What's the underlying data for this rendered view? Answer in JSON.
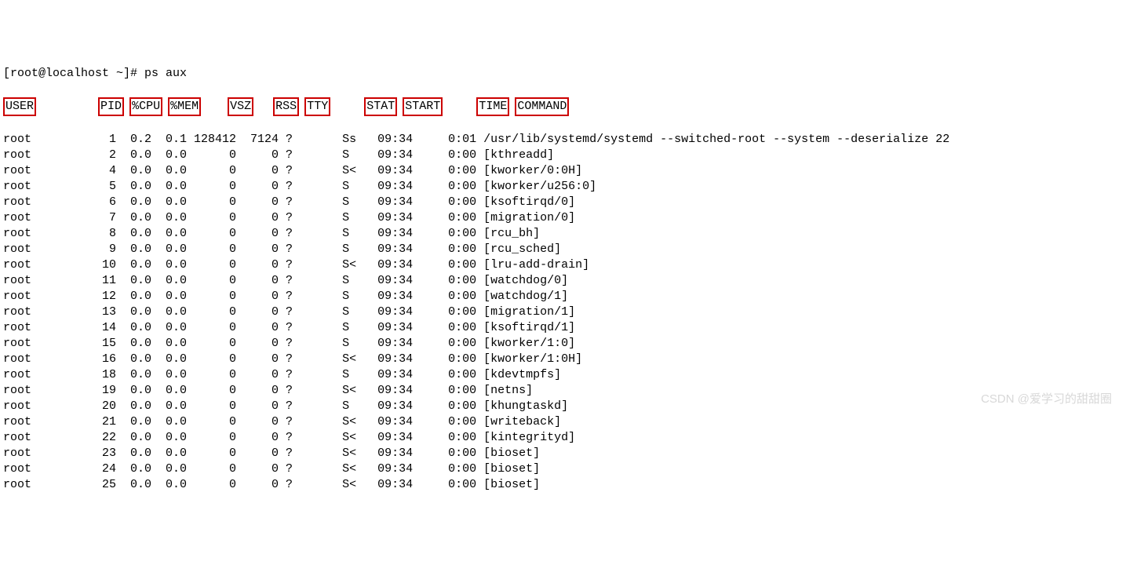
{
  "prompt": "[root@localhost ~]# ps aux",
  "headers": [
    "USER",
    "PID",
    "%CPU",
    "%MEM",
    "VSZ",
    "RSS",
    "TTY",
    "STAT",
    "START",
    "TIME",
    "COMMAND"
  ],
  "col_widths": {
    "user": 8,
    "pid": 8,
    "cpu": 5,
    "mem": 5,
    "vsz": 7,
    "rss": 6,
    "tty": 9,
    "stat": 5,
    "start": 7,
    "time": 7
  },
  "rows": [
    {
      "user": "root",
      "pid": 1,
      "cpu": "0.2",
      "mem": "0.1",
      "vsz": 128412,
      "rss": 7124,
      "tty": "?",
      "stat": "Ss",
      "start": "09:34",
      "time": "0:01",
      "command": "/usr/lib/systemd/systemd --switched-root --system --deserialize 22"
    },
    {
      "user": "root",
      "pid": 2,
      "cpu": "0.0",
      "mem": "0.0",
      "vsz": 0,
      "rss": 0,
      "tty": "?",
      "stat": "S",
      "start": "09:34",
      "time": "0:00",
      "command": "[kthreadd]"
    },
    {
      "user": "root",
      "pid": 4,
      "cpu": "0.0",
      "mem": "0.0",
      "vsz": 0,
      "rss": 0,
      "tty": "?",
      "stat": "S<",
      "start": "09:34",
      "time": "0:00",
      "command": "[kworker/0:0H]"
    },
    {
      "user": "root",
      "pid": 5,
      "cpu": "0.0",
      "mem": "0.0",
      "vsz": 0,
      "rss": 0,
      "tty": "?",
      "stat": "S",
      "start": "09:34",
      "time": "0:00",
      "command": "[kworker/u256:0]"
    },
    {
      "user": "root",
      "pid": 6,
      "cpu": "0.0",
      "mem": "0.0",
      "vsz": 0,
      "rss": 0,
      "tty": "?",
      "stat": "S",
      "start": "09:34",
      "time": "0:00",
      "command": "[ksoftirqd/0]"
    },
    {
      "user": "root",
      "pid": 7,
      "cpu": "0.0",
      "mem": "0.0",
      "vsz": 0,
      "rss": 0,
      "tty": "?",
      "stat": "S",
      "start": "09:34",
      "time": "0:00",
      "command": "[migration/0]"
    },
    {
      "user": "root",
      "pid": 8,
      "cpu": "0.0",
      "mem": "0.0",
      "vsz": 0,
      "rss": 0,
      "tty": "?",
      "stat": "S",
      "start": "09:34",
      "time": "0:00",
      "command": "[rcu_bh]"
    },
    {
      "user": "root",
      "pid": 9,
      "cpu": "0.0",
      "mem": "0.0",
      "vsz": 0,
      "rss": 0,
      "tty": "?",
      "stat": "S",
      "start": "09:34",
      "time": "0:00",
      "command": "[rcu_sched]"
    },
    {
      "user": "root",
      "pid": 10,
      "cpu": "0.0",
      "mem": "0.0",
      "vsz": 0,
      "rss": 0,
      "tty": "?",
      "stat": "S<",
      "start": "09:34",
      "time": "0:00",
      "command": "[lru-add-drain]"
    },
    {
      "user": "root",
      "pid": 11,
      "cpu": "0.0",
      "mem": "0.0",
      "vsz": 0,
      "rss": 0,
      "tty": "?",
      "stat": "S",
      "start": "09:34",
      "time": "0:00",
      "command": "[watchdog/0]"
    },
    {
      "user": "root",
      "pid": 12,
      "cpu": "0.0",
      "mem": "0.0",
      "vsz": 0,
      "rss": 0,
      "tty": "?",
      "stat": "S",
      "start": "09:34",
      "time": "0:00",
      "command": "[watchdog/1]"
    },
    {
      "user": "root",
      "pid": 13,
      "cpu": "0.0",
      "mem": "0.0",
      "vsz": 0,
      "rss": 0,
      "tty": "?",
      "stat": "S",
      "start": "09:34",
      "time": "0:00",
      "command": "[migration/1]"
    },
    {
      "user": "root",
      "pid": 14,
      "cpu": "0.0",
      "mem": "0.0",
      "vsz": 0,
      "rss": 0,
      "tty": "?",
      "stat": "S",
      "start": "09:34",
      "time": "0:00",
      "command": "[ksoftirqd/1]"
    },
    {
      "user": "root",
      "pid": 15,
      "cpu": "0.0",
      "mem": "0.0",
      "vsz": 0,
      "rss": 0,
      "tty": "?",
      "stat": "S",
      "start": "09:34",
      "time": "0:00",
      "command": "[kworker/1:0]"
    },
    {
      "user": "root",
      "pid": 16,
      "cpu": "0.0",
      "mem": "0.0",
      "vsz": 0,
      "rss": 0,
      "tty": "?",
      "stat": "S<",
      "start": "09:34",
      "time": "0:00",
      "command": "[kworker/1:0H]"
    },
    {
      "user": "root",
      "pid": 18,
      "cpu": "0.0",
      "mem": "0.0",
      "vsz": 0,
      "rss": 0,
      "tty": "?",
      "stat": "S",
      "start": "09:34",
      "time": "0:00",
      "command": "[kdevtmpfs]"
    },
    {
      "user": "root",
      "pid": 19,
      "cpu": "0.0",
      "mem": "0.0",
      "vsz": 0,
      "rss": 0,
      "tty": "?",
      "stat": "S<",
      "start": "09:34",
      "time": "0:00",
      "command": "[netns]"
    },
    {
      "user": "root",
      "pid": 20,
      "cpu": "0.0",
      "mem": "0.0",
      "vsz": 0,
      "rss": 0,
      "tty": "?",
      "stat": "S",
      "start": "09:34",
      "time": "0:00",
      "command": "[khungtaskd]"
    },
    {
      "user": "root",
      "pid": 21,
      "cpu": "0.0",
      "mem": "0.0",
      "vsz": 0,
      "rss": 0,
      "tty": "?",
      "stat": "S<",
      "start": "09:34",
      "time": "0:00",
      "command": "[writeback]"
    },
    {
      "user": "root",
      "pid": 22,
      "cpu": "0.0",
      "mem": "0.0",
      "vsz": 0,
      "rss": 0,
      "tty": "?",
      "stat": "S<",
      "start": "09:34",
      "time": "0:00",
      "command": "[kintegrityd]"
    },
    {
      "user": "root",
      "pid": 23,
      "cpu": "0.0",
      "mem": "0.0",
      "vsz": 0,
      "rss": 0,
      "tty": "?",
      "stat": "S<",
      "start": "09:34",
      "time": "0:00",
      "command": "[bioset]"
    },
    {
      "user": "root",
      "pid": 24,
      "cpu": "0.0",
      "mem": "0.0",
      "vsz": 0,
      "rss": 0,
      "tty": "?",
      "stat": "S<",
      "start": "09:34",
      "time": "0:00",
      "command": "[bioset]"
    },
    {
      "user": "root",
      "pid": 25,
      "cpu": "0.0",
      "mem": "0.0",
      "vsz": 0,
      "rss": 0,
      "tty": "?",
      "stat": "S<",
      "start": "09:34",
      "time": "0:00",
      "command": "[bioset]"
    }
  ],
  "watermark": "CSDN @爱学习的甜甜圈"
}
